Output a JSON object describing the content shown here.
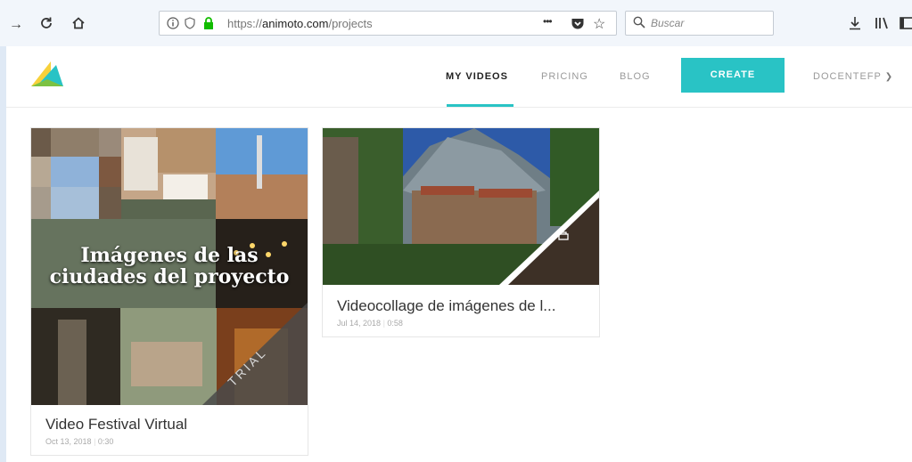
{
  "browser": {
    "url_prefix": "https://",
    "url_domain": "animoto.com",
    "url_path": "/projects",
    "search_placeholder": "Buscar",
    "more_glyph": "•••"
  },
  "header": {
    "nav": [
      "MY VIDEOS",
      "PRICING",
      "BLOG"
    ],
    "create_label": "CREATE",
    "user_label": "DOCENTEFP"
  },
  "projects": [
    {
      "overlay_line1": "Imágenes de las",
      "overlay_line2": "ciudades del proyecto",
      "badge": "TRIAL",
      "title": "Video Festival Virtual",
      "date": "Oct 13, 2018",
      "duration": "0:30"
    },
    {
      "title": "Videocollage de imágenes de l...",
      "date": "Jul 14, 2018",
      "duration": "0:58"
    }
  ],
  "icons": [
    "back-arrow-icon",
    "reload-icon",
    "home-icon",
    "info-icon",
    "tracking-shield-icon",
    "lock-icon",
    "pocket-icon",
    "star-icon",
    "search-icon",
    "download-icon",
    "library-icon",
    "sidebar-icon",
    "chevron-down-icon",
    "logo"
  ]
}
